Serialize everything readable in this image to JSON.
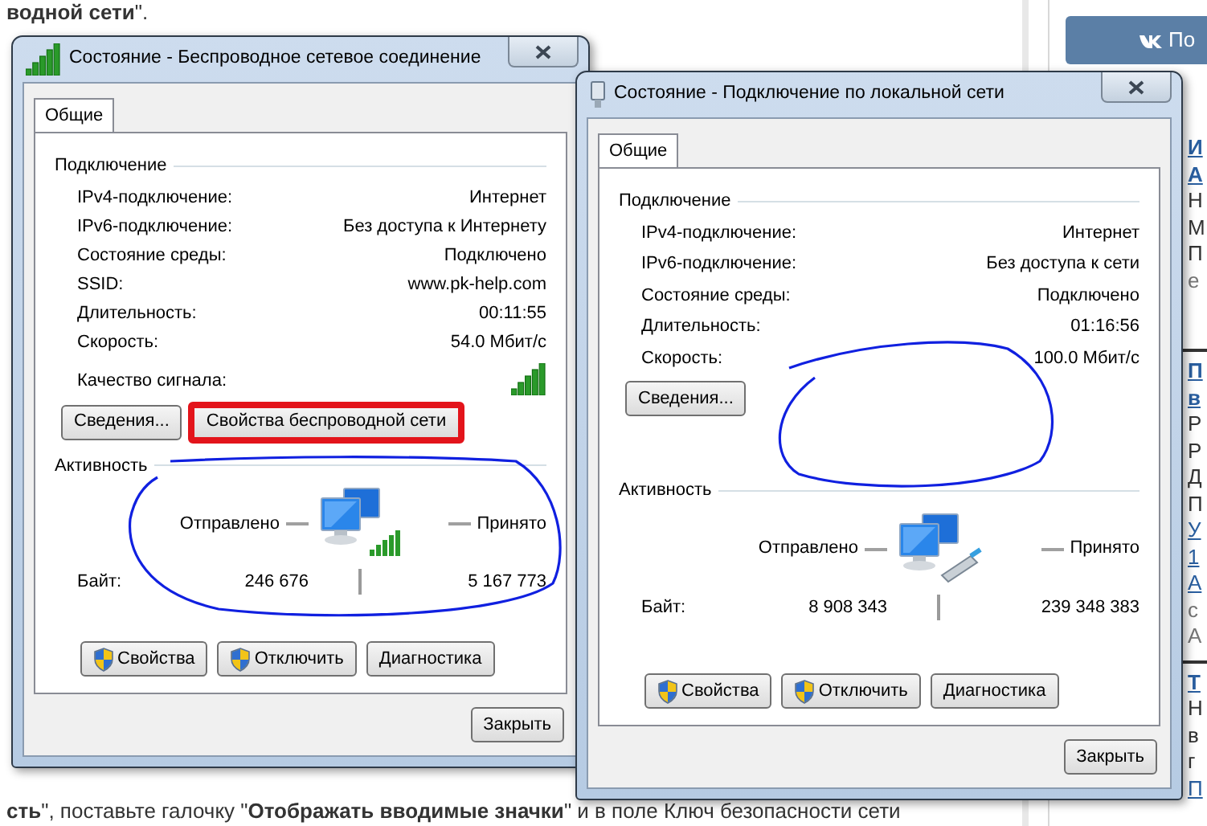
{
  "article_top": "**водной сети**\".",
  "dialogs": [
    {
      "kind": "wireless",
      "title": "Состояние - Беспроводное сетевое соединение",
      "tab": {
        "label": "Общие",
        "selected": true
      },
      "connection_label": "Подключение",
      "rows": [
        {
          "label": "IPv4-подключение:",
          "value": "Интернет"
        },
        {
          "label": "IPv6-подключение:",
          "value": "Без доступа к Интернету"
        },
        {
          "label": "Состояние среды:",
          "value": "Подключено"
        },
        {
          "label": "SSID:",
          "value": "www.pk-help.com"
        },
        {
          "label": "Длительность:",
          "value": "00:11:55"
        },
        {
          "label": "Скорость:",
          "value": "54.0 Мбит/с"
        }
      ],
      "signal_label": "Качество сигнала:",
      "detail_buttons": [
        {
          "label": "Сведения...",
          "highlighted": false
        },
        {
          "label": "Свойства беспроводной сети",
          "highlighted": true
        }
      ],
      "activity": {
        "label": "Активность",
        "sent_label": "Отправлено",
        "received_label": "Принято",
        "bytes_label": "Байт:",
        "sent": "246 676",
        "received": "5 167 773"
      },
      "buttons": [
        {
          "label": "Свойства",
          "shield": true
        },
        {
          "label": "Отключить",
          "shield": true
        },
        {
          "label": "Диагностика",
          "shield": false
        }
      ],
      "close": "Закрыть"
    },
    {
      "kind": "wired",
      "title": "Состояние - Подключение по локальной сети",
      "tab": {
        "label": "Общие",
        "selected": true
      },
      "connection_label": "Подключение",
      "rows": [
        {
          "label": "IPv4-подключение:",
          "value": "Интернет"
        },
        {
          "label": "IPv6-подключение:",
          "value": "Без доступа к сети"
        },
        {
          "label": "Состояние среды:",
          "value": "Подключено"
        },
        {
          "label": "Длительность:",
          "value": "01:16:56"
        },
        {
          "label": "Скорость:",
          "value": "100.0 Мбит/с"
        }
      ],
      "detail_buttons": [
        {
          "label": "Сведения...",
          "highlighted": false
        }
      ],
      "activity": {
        "label": "Активность",
        "sent_label": "Отправлено",
        "received_label": "Принято",
        "bytes_label": "Байт:",
        "sent": "8 908 343",
        "received": "239 348 383"
      },
      "buttons": [
        {
          "label": "Свойства",
          "shield": true
        },
        {
          "label": "Отключить",
          "shield": true
        },
        {
          "label": "Диагностика",
          "shield": false
        }
      ],
      "close": "Закрыть"
    }
  ],
  "article_bottom": "**сть**\", поставьте галочку \"**Отображать вводимые значки**\" и в поле Ключ безопасности сети",
  "vk_button": {
    "label": "По"
  },
  "sidebar": [
    {
      "lines": [
        {
          "text": "И",
          "kind": "title"
        },
        {
          "text": "А",
          "kind": "title"
        },
        {
          "text": "Н",
          "kind": "text"
        },
        {
          "text": "М",
          "kind": "text"
        },
        {
          "text": "П",
          "kind": "text"
        },
        {
          "text": "е",
          "kind": "meta"
        }
      ]
    },
    {
      "lines": [
        {
          "text": "П",
          "kind": "title"
        },
        {
          "text": "в",
          "kind": "title"
        },
        {
          "text": "Р",
          "kind": "text"
        },
        {
          "text": "Р",
          "kind": "text"
        },
        {
          "text": "Д",
          "kind": "text"
        },
        {
          "text": "П",
          "kind": "text"
        },
        {
          "text": "У",
          "kind": "link"
        },
        {
          "text": "1",
          "kind": "link"
        },
        {
          "text": "А",
          "kind": "link"
        },
        {
          "text": "с",
          "kind": "meta"
        },
        {
          "text": "А",
          "kind": "meta"
        }
      ]
    },
    {
      "lines": [
        {
          "text": "Т",
          "kind": "title"
        },
        {
          "text": "Н",
          "kind": "text"
        },
        {
          "text": "в",
          "kind": "text"
        },
        {
          "text": "г",
          "kind": "text"
        },
        {
          "text": "П",
          "kind": "link"
        }
      ]
    }
  ]
}
